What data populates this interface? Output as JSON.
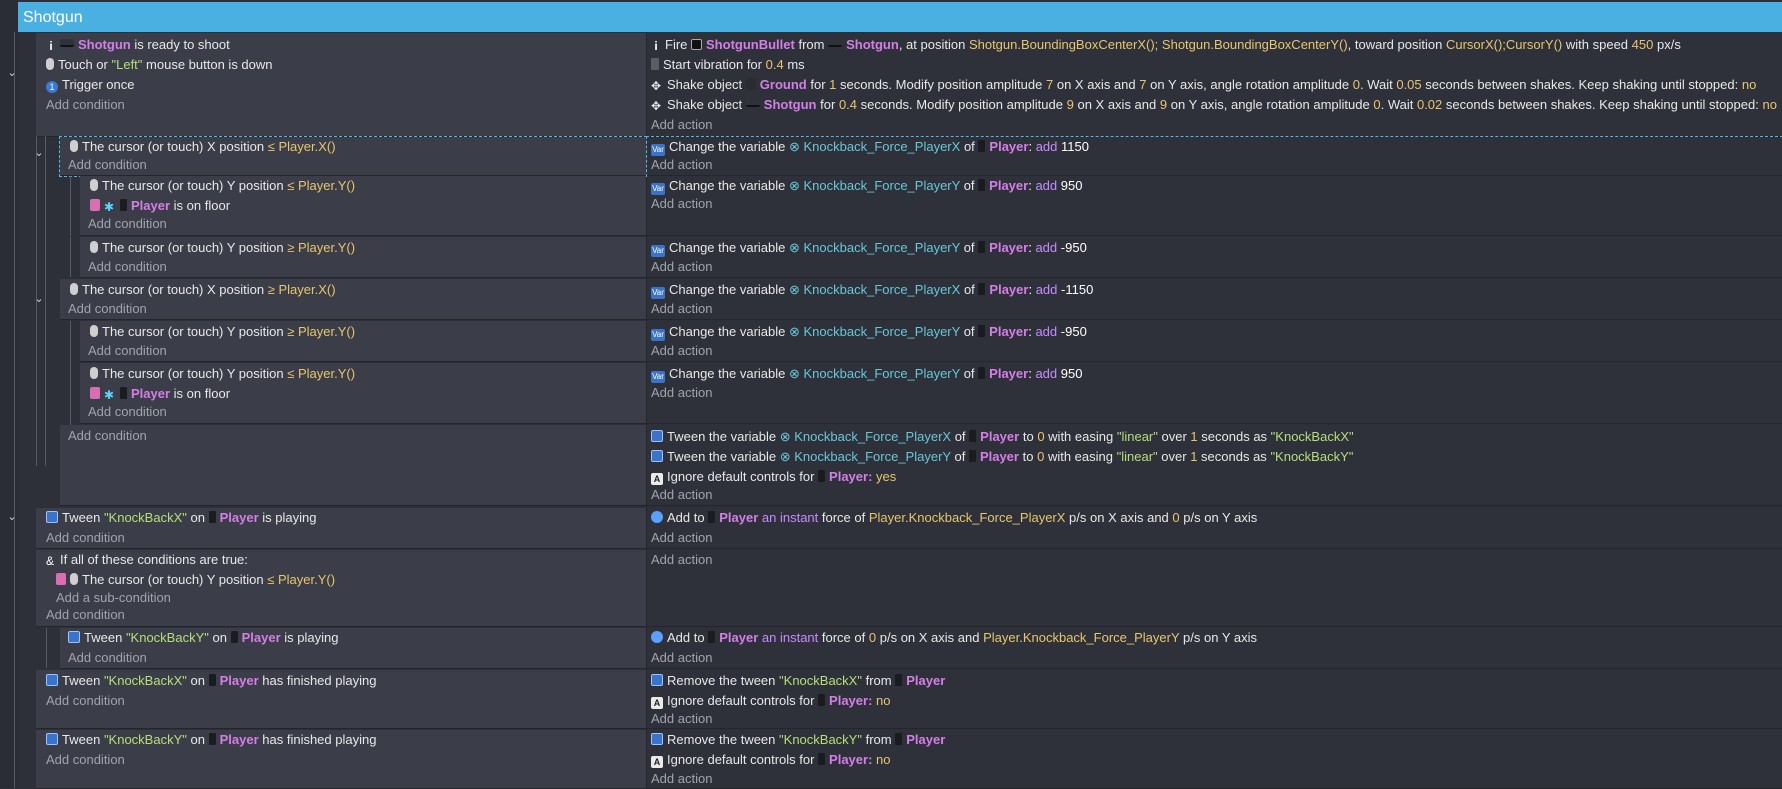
{
  "group": {
    "title": "Shotgun"
  },
  "labels": {
    "add_condition": "Add condition",
    "add_action": "Add action",
    "add_subcondition": "Add a sub-condition"
  },
  "ev1": {
    "c1_obj": "Shotgun",
    "c1_rest": "is ready to shoot",
    "c2_a": "Touch or",
    "c2_str": "\"Left\"",
    "c2_b": "mouse button is down",
    "c3": "Trigger once",
    "a1_a": "Fire",
    "a1_obj1": "ShotgunBullet",
    "a1_b": "from",
    "a1_obj2": "Shotgun",
    "a1_c": ", at position",
    "a1_ex1": "Shotgun.BoundingBoxCenterX();",
    "a1_ex2": "Shotgun.BoundingBoxCenterY()",
    "a1_d": ", toward position",
    "a1_ex3": "CursorX();CursorY()",
    "a1_e": "with speed",
    "a1_num": "450",
    "a1_f": "px/s",
    "a2_a": "Start vibration for",
    "a2_num": "0.4",
    "a2_b": "ms",
    "a3_a": "Shake object",
    "a3_obj": "Ground",
    "a3_b": "for",
    "a3_n1": "1",
    "a3_c": "seconds. Modify position amplitude",
    "a3_n2": "7",
    "a3_d": "on X axis and",
    "a3_n3": "7",
    "a3_e": "on Y axis, angle rotation amplitude",
    "a3_n4": "0",
    "a3_f": ". Wait",
    "a3_n5": "0.05",
    "a3_g": "seconds between shakes. Keep shaking until stopped:",
    "a3_n6": "no",
    "a4_a": "Shake object",
    "a4_obj": "Shotgun",
    "a4_b": "for",
    "a4_n1": "0.4",
    "a4_c": "seconds. Modify position amplitude",
    "a4_n2": "9",
    "a4_d": "on X axis and",
    "a4_n3": "9",
    "a4_e": "on Y axis, angle rotation amplitude",
    "a4_n4": "0",
    "a4_f": ". Wait",
    "a4_n5": "0.02",
    "a4_g": "seconds between shakes. Keep shaking until stopped:",
    "a4_n6": "no"
  },
  "sub": {
    "cx_le": "The cursor (or touch) X position",
    "op_le": "≤",
    "op_ge": "≥",
    "px": "Player.X()",
    "py": "Player.Y()",
    "cy": "The cursor (or touch) Y position",
    "player": "Player",
    "on_floor": "is on floor",
    "chg": "Change the variable",
    "vx": "Knockback_Force_PlayerX",
    "vy": "Knockback_Force_PlayerY",
    "of": "of",
    "add": "add",
    "v1150": "1150",
    "v950": "950",
    "vm950": "-950",
    "vm1150": "-1150"
  },
  "tw": {
    "a1": "Tween the variable",
    "vx": "Knockback_Force_PlayerX",
    "of": "of",
    "player": "Player",
    "to": "to",
    "zero": "0",
    "ease": "with easing",
    "lin": "\"linear\"",
    "over": "over",
    "one": "1",
    "sec": "seconds as",
    "kx": "\"KnockBackX\"",
    "vy": "Knockback_Force_PlayerY",
    "ky": "\"KnockBackY\"",
    "ign": "Ignore default controls for",
    "yes": "yes",
    "no": "no"
  },
  "ev3": {
    "tween": "Tween",
    "kx": "\"KnockBackX\"",
    "on": "on",
    "player": "Player",
    "playing": "is playing",
    "add_to": "Add to",
    "inst": "an instant",
    "force_of": "force of",
    "fx": "Player.Knockback_Force_PlayerX",
    "ps_x": "p/s on X axis and",
    "zero": "0",
    "ps_y": "p/s on Y axis"
  },
  "ev4": {
    "all_true": "If all of these conditions are true:",
    "cy": "The cursor (or touch) Y position",
    "op": "≤",
    "py": "Player.Y()"
  },
  "ev5": {
    "ky": "\"KnockBackY\"",
    "fy": "Player.Knockback_Force_PlayerY"
  },
  "ev6": {
    "finished": "has finished playing",
    "remove": "Remove the tween",
    "from": "from"
  }
}
